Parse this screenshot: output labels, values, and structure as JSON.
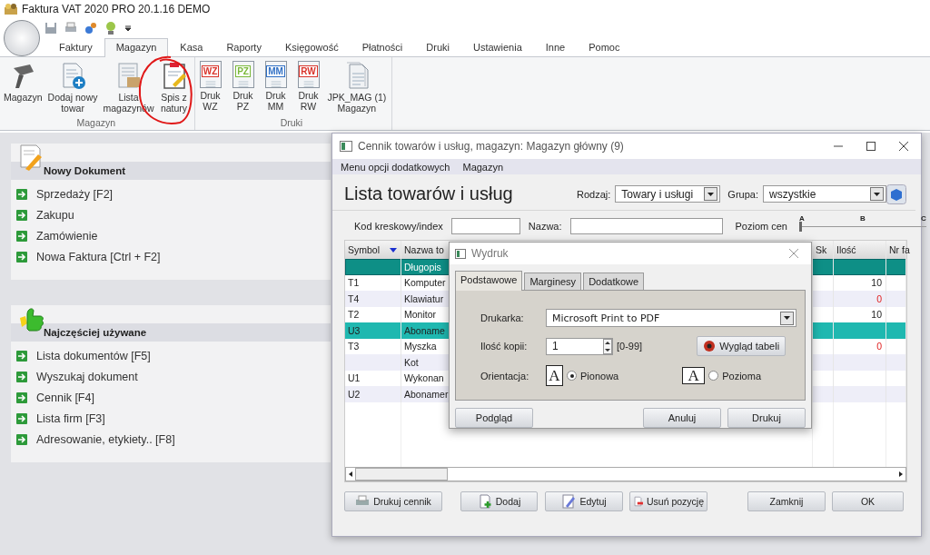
{
  "app": {
    "title": "Faktura VAT 2020 PRO 20.1.16 DEMO"
  },
  "tabs": [
    {
      "label": "Faktury",
      "selected": false
    },
    {
      "label": "Magazyn",
      "selected": true
    },
    {
      "label": "Kasa",
      "selected": false
    },
    {
      "label": "Raporty",
      "selected": false
    },
    {
      "label": "Księgowość",
      "selected": false
    },
    {
      "label": "Płatności",
      "selected": false
    },
    {
      "label": "Druki",
      "selected": false
    },
    {
      "label": "Ustawienia",
      "selected": false
    },
    {
      "label": "Inne",
      "selected": false
    },
    {
      "label": "Pomoc",
      "selected": false
    }
  ],
  "ribbon": {
    "groups": [
      {
        "label": "Magazyn",
        "buttons": [
          {
            "lines": [
              "Magazyn"
            ],
            "kind": "scanner"
          },
          {
            "lines": [
              "Dodaj nowy",
              "towar"
            ],
            "kind": "add"
          },
          {
            "lines": [
              "Lista",
              "magazynów"
            ],
            "kind": "list"
          },
          {
            "lines": [
              "Spis z",
              "natury"
            ],
            "kind": "clipboard"
          }
        ]
      },
      {
        "label": "Druki",
        "buttons": [
          {
            "lines": [
              "Druk",
              "WZ"
            ],
            "kind": "coded",
            "code": "WZ",
            "color": "#d9342b"
          },
          {
            "lines": [
              "Druk",
              "PZ"
            ],
            "kind": "coded",
            "code": "PZ",
            "color": "#7ab83a"
          },
          {
            "lines": [
              "Druk",
              "MM"
            ],
            "kind": "coded",
            "code": "MM",
            "color": "#2f6fc4"
          },
          {
            "lines": [
              "Druk",
              "RW"
            ],
            "kind": "coded",
            "code": "RW",
            "color": "#d9342b"
          },
          {
            "lines": [
              "JPK_MAG (1)",
              "Magazyn"
            ],
            "kind": "pages"
          }
        ]
      }
    ]
  },
  "panels": [
    {
      "title": "Nowy Dokument",
      "kind": "new",
      "items": [
        "Sprzedaży [F2]",
        "Zakupu",
        "Zamówienie",
        "Nowa Faktura [Ctrl + F2]"
      ]
    },
    {
      "title": "Najczęściej używane",
      "kind": "favorite",
      "items": [
        "Lista dokumentów [F5]",
        "Wyszukaj dokument",
        "Cennik [F4]",
        "Lista firm [F3]",
        "Adresowanie, etykiety.. [F8]"
      ]
    }
  ],
  "cennik": {
    "title": "Cennik towarów i usług, magazyn: Magazyn główny (9)",
    "menu": [
      "Menu opcji dodatkowych",
      "Magazyn"
    ],
    "heading": "Lista towarów i usług",
    "rodzaj_label": "Rodzaj:",
    "rodzaj_value": "Towary i usługi",
    "grupa_label": "Grupa:",
    "grupa_value": "wszystkie",
    "code_label": "Kod kreskowy/index",
    "name_label": "Nazwa:",
    "price_level_label": "Poziom cen",
    "price_levels": [
      "A",
      "B",
      "C"
    ],
    "level": 0,
    "columns": [
      {
        "label": "Symbol",
        "sorted": true
      },
      {
        "label": "Nazwa to"
      },
      {
        "label": "Sk"
      },
      {
        "label": "Ilość"
      },
      {
        "label": "Nr fa"
      }
    ],
    "rows": [
      {
        "symbol": "",
        "name": "Długopis",
        "focused": true,
        "selected": false
      },
      {
        "symbol": "T1",
        "name": "Komputer",
        "qty": {
          "value": "10",
          "alert": false
        },
        "focused": false,
        "selected": false
      },
      {
        "symbol": "T4",
        "name": "Klawiatur",
        "qty": {
          "value": "0",
          "alert": true
        },
        "focused": false,
        "selected": false
      },
      {
        "symbol": "T2",
        "name": "Monitor",
        "qty": {
          "value": "10",
          "alert": false
        },
        "focused": false,
        "selected": false
      },
      {
        "symbol": "U3",
        "name": "Aboname",
        "focused": false,
        "selected": true
      },
      {
        "symbol": "T3",
        "name": "Myszka",
        "qty": {
          "value": "0",
          "alert": true
        },
        "focused": false,
        "selected": false
      },
      {
        "symbol": "",
        "name": "Kot",
        "focused": false,
        "selected": false
      },
      {
        "symbol": "U1",
        "name": "Wykonan",
        "focused": false,
        "selected": false
      },
      {
        "symbol": "U2",
        "name": "Abonamer",
        "focused": false,
        "selected": false
      }
    ],
    "buttons": [
      {
        "label": "Drukuj cennik",
        "kind": "print"
      },
      {
        "label": "Dodaj",
        "kind": "add"
      },
      {
        "label": "Edytuj",
        "kind": "edit"
      },
      {
        "label": "Usuń pozycję",
        "kind": "remove"
      },
      {
        "label": "Zamknij",
        "kind": "plain"
      },
      {
        "label": "OK",
        "kind": "plain"
      }
    ]
  },
  "dialog": {
    "title": "Wydruk",
    "tabs": [
      {
        "label": "Podstawowe",
        "selected": true
      },
      {
        "label": "Marginesy",
        "selected": false
      },
      {
        "label": "Dodatkowe",
        "selected": false
      }
    ],
    "printer_label": "Drukarka:",
    "printer_value": "Microsoft Print to PDF",
    "copies_label": "Ilość kopii:",
    "copies_value": "1",
    "copies_range": "[0-99]",
    "table_button": "Wygląd tabeli",
    "orientation_label": "Orientacja:",
    "orientations": [
      {
        "glyph": "A",
        "label": "Pionowa",
        "kind": "portrait",
        "selected": true
      },
      {
        "glyph": "A",
        "label": "Pozioma",
        "kind": "landscape",
        "selected": false
      }
    ],
    "buttons": [
      "Podgląd",
      "Anuluj",
      "Drukuj"
    ]
  }
}
